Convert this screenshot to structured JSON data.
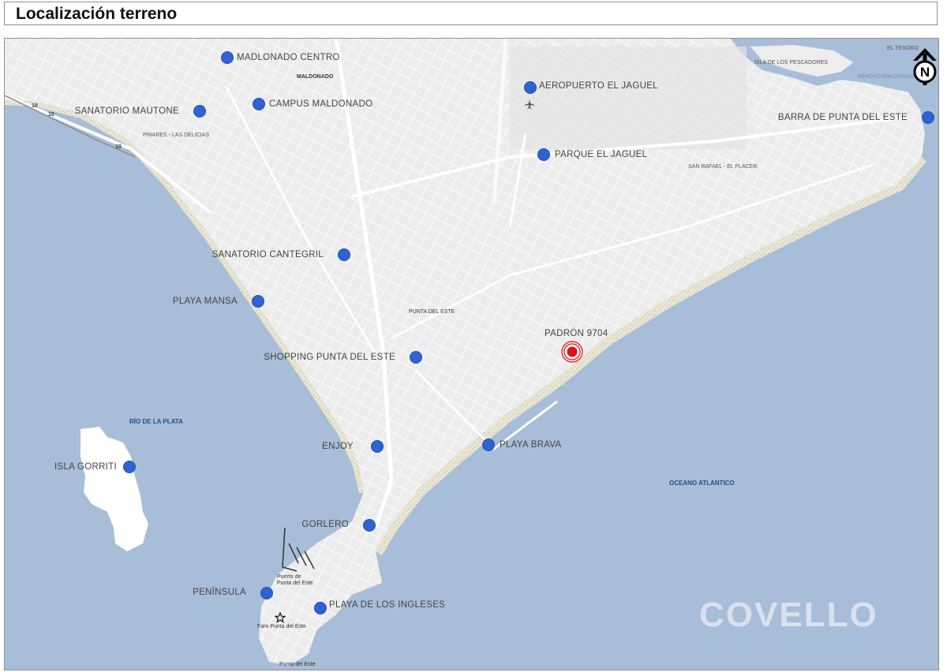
{
  "title": "Localización terreno",
  "watermark": "COVELLO",
  "north_label": "N",
  "colors": {
    "sea": "#a8bdd8",
    "land": "#f1f1f1",
    "poi": "#2f63d3",
    "target": "#e01010"
  },
  "target": {
    "label": "PADRÓN 9704"
  },
  "pois": [
    {
      "id": "madlonado-centro",
      "label": "MADLONADO CENTRO"
    },
    {
      "id": "campus-maldonado",
      "label": "CAMPUS MALDONADO"
    },
    {
      "id": "sanatorio-mautone",
      "label": "SANATORIO MAUTONE"
    },
    {
      "id": "aeropuerto-el-jaguel",
      "label": "AEROPUERTO  EL JAGUEL"
    },
    {
      "id": "parque-el-jaguel",
      "label": "PARQUE EL JAGUEL"
    },
    {
      "id": "barra-de-punta-del-este",
      "label": "BARRA DE PUNTA DEL ESTE"
    },
    {
      "id": "sanatorio-cantegril",
      "label": "SANATORIO CANTEGRIL"
    },
    {
      "id": "playa-mansa",
      "label": "PLAYA MANSA"
    },
    {
      "id": "shopping-punta-del-este",
      "label": "SHOPPING PUNTA DEL ESTE"
    },
    {
      "id": "enjoy",
      "label": "ENJOY"
    },
    {
      "id": "playa-brava",
      "label": "PLAYA BRAVA"
    },
    {
      "id": "isla-gorriti",
      "label": "ISLA GORRITI"
    },
    {
      "id": "gorlero",
      "label": "GORLERO"
    },
    {
      "id": "peninsula",
      "label": "PENÍNSULA"
    },
    {
      "id": "playa-de-los-ingleses",
      "label": "PLAYA DE LOS INGLESES"
    }
  ],
  "map_labels": {
    "maldonado": "MALDONADO",
    "pinares": "PINARES - LAS DELICIAS",
    "san_rafael": "SAN RAFAEL - EL PLACER",
    "punta_del_este_city": "PUNTA DEL ESTE",
    "rio_de_la_plata": "RÍO DE LA PLATA",
    "oceano_atlantico": "OCEANO ATLANTICO",
    "isla_de_los_pescadores": "ISLA DE LOS PESCADORES",
    "arroyo_maldonado": "ARROYO MALDONADO",
    "el_tesoro": "EL TESORO",
    "puerto_line1": "Puerto de",
    "puerto_line2": "Punta del Este",
    "faro": "Faro Punta del Este",
    "punta_del_este_tip": "Punta del Este",
    "route_10": "10"
  }
}
